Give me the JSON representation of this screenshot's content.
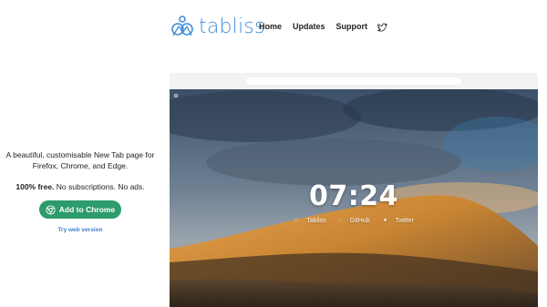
{
  "header": {
    "logo_text": "tabliss",
    "nav": [
      {
        "label": "Home"
      },
      {
        "label": "Updates"
      },
      {
        "label": "Support"
      }
    ]
  },
  "intro": {
    "tagline": "A beautiful, customisable New Tab page for Firefox, Chrome, and Edge.",
    "free_bold": "100% free.",
    "free_rest": " No subscriptions. No ads.",
    "cta_label": "Add to Chrome",
    "web_link_label": "Try web version"
  },
  "preview": {
    "time": "07:24",
    "links": [
      {
        "icon": "star-icon",
        "label": "Tabliss"
      },
      {
        "icon": "github-icon",
        "label": "GitHub"
      },
      {
        "icon": "twitter-icon",
        "label": "Twitter"
      }
    ]
  },
  "colors": {
    "brand": "#3f8fd9",
    "cta": "#2d9b6a",
    "link": "#3f7fc8"
  }
}
